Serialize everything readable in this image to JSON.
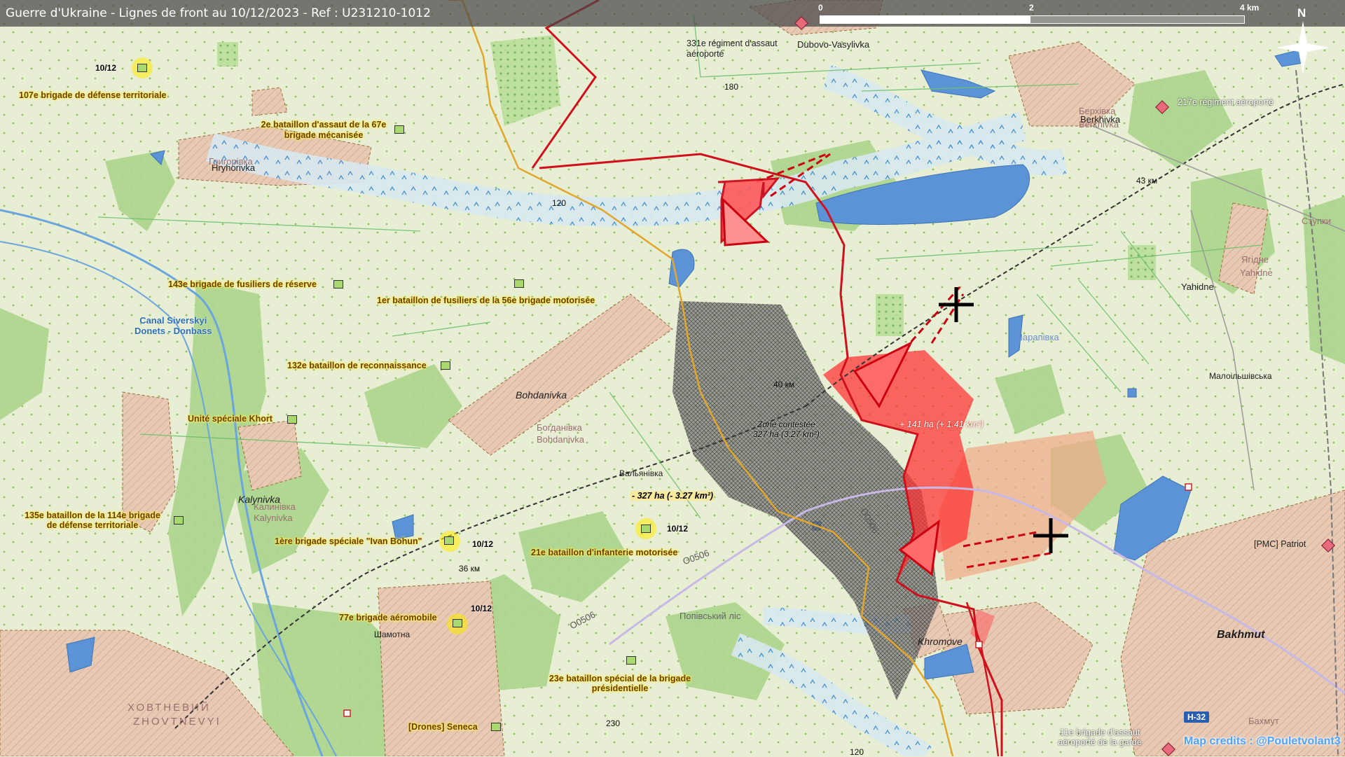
{
  "header": {
    "title": "Guerre d'Ukraine - Lignes de front au 10/12/2023 - Ref : U231210-1012"
  },
  "scale": {
    "labels": [
      "0",
      "2",
      "4 km"
    ],
    "north": "N"
  },
  "credits": "Map credits : @Pouletvolant3",
  "colors": {
    "front_line": "#d0101c",
    "ua_gain": "#ff3030",
    "contested": "#6b6b6b",
    "river": "#5f9ad8",
    "forest": "#a9d48a",
    "urban": "#e2c7b5"
  },
  "units": [
    {
      "label": "107e brigade de défense territoriale"
    },
    {
      "label": "2e bataillon d'assaut de la 67e"
    },
    {
      "label": "brigade mécanisée"
    },
    {
      "label": "143e brigade de fusiliers de réserve"
    },
    {
      "label": "1er bataillon de fusiliers de la 56e brigade motorisée"
    },
    {
      "label": "132e bataillon de reconnaissance"
    },
    {
      "label": "Unité spéciale Khort"
    },
    {
      "label": "135e bataillon de la 114e brigade"
    },
    {
      "label": "de défense territoriale"
    },
    {
      "label": "1ère brigade spéciale \"Ivan Bohun\""
    },
    {
      "label": "21e bataillon d'infanterie motorisée"
    },
    {
      "label": "77e brigade aéromobile"
    },
    {
      "label": "23e bataillon spécial de la brigade"
    },
    {
      "label": "présidentielle"
    },
    {
      "label": "[Drones] Seneca"
    },
    {
      "label": "331e régiment d'assaut"
    },
    {
      "label": "aéroporté"
    },
    {
      "label": "217e régiment aéroporté"
    },
    {
      "label": "[PMC] Patriot"
    },
    {
      "label": "11e brigade d'assaut"
    },
    {
      "label": "aéroporté de la garde"
    }
  ],
  "dates": [
    "10/12",
    "10/12",
    "10/12",
    "10/12"
  ],
  "places": [
    "Dubovo-Vasylivka",
    "Hryhorivka",
    "Berkhivka",
    "Yahidne",
    "Bohdanivka",
    "Kalynivka",
    "Khromove",
    "Bakhmut",
    "Вальянівка",
    "Шамотна",
    "Малоільшівська",
    "Попівський ліс",
    "Богданівка",
    "Bohdanivka",
    "Калинівка",
    "Kalynivka",
    "Ягідне",
    "Yahidne",
    "Ступки",
    "ХОВТНЕВИЙ",
    "ZHOVTNEVYI",
    "Бахмут",
    "Берхівка",
    "Berkhivka",
    "Шарапівка",
    "Григорівка"
  ],
  "canal": [
    "Canal Siverskyi",
    "Donets - Donbass"
  ],
  "numbers": [
    "180",
    "120",
    "40 км",
    "43 км",
    "36 км",
    "230",
    "120"
  ],
  "zones": {
    "contested": [
      "Zone contestée",
      "327 ha (3.27 km²)"
    ],
    "loss": "- 327 ha (- 3.27 km²)",
    "gain": "+ 141 ha (+ 1.41 km²)"
  },
  "roads": [
    "H-32",
    "O0506",
    "O0506",
    "O0506"
  ]
}
